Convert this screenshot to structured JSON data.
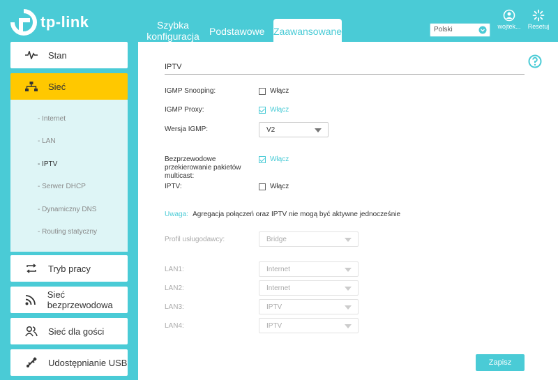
{
  "brand": {
    "name": "tp-link",
    "color": "#4acbd6"
  },
  "nav": {
    "quick_line1": "Szybka",
    "quick_line2": "konfiguracja",
    "basic": "Podstawowe",
    "advanced": "Zaawansowane"
  },
  "header": {
    "language": "Polski",
    "user_label": "wojtek...",
    "reset_label": "Resetuj"
  },
  "sidebar": {
    "items": [
      {
        "label": "Stan",
        "icon": "pulse-icon"
      },
      {
        "label": "Sieć",
        "icon": "network-icon"
      },
      {
        "label": "Tryb pracy",
        "icon": "loop-icon"
      },
      {
        "label": "Sieć bezprzewodowa",
        "icon": "wifi-icon"
      },
      {
        "label": "Sieć dla gości",
        "icon": "guests-icon"
      },
      {
        "label": "Udostępnianie USB",
        "icon": "usb-icon"
      }
    ],
    "submenu": [
      "- Internet",
      "- LAN",
      "- IPTV",
      "- Serwer DHCP",
      "- Dynamiczny DNS",
      "- Routing statyczny"
    ]
  },
  "form": {
    "title": "IPTV",
    "igmp_snooping": {
      "label": "IGMP Snooping:",
      "option": "Włącz",
      "checked": false
    },
    "igmp_proxy": {
      "label": "IGMP Proxy:",
      "option": "Włącz",
      "checked": true
    },
    "igmp_version": {
      "label": "Wersja IGMP:",
      "value": "V2"
    },
    "wireless_multicast": {
      "label_line1": "Bezprzewodowe",
      "label_line2": "przekierowanie pakietów",
      "label_line3": "multicast:",
      "option": "Włącz",
      "checked": true
    },
    "iptv": {
      "label": "IPTV:",
      "option": "Włącz",
      "checked": false
    },
    "note": {
      "label": "Uwaga:",
      "text": "Agregacja połączeń oraz IPTV nie mogą być aktywne jednocześnie"
    },
    "provider_profile": {
      "label": "Profil usługodawcy:",
      "value": "Bridge"
    },
    "lans": [
      {
        "label": "LAN1:",
        "value": "Internet"
      },
      {
        "label": "LAN2:",
        "value": "Internet"
      },
      {
        "label": "LAN3:",
        "value": "IPTV"
      },
      {
        "label": "LAN4:",
        "value": "IPTV"
      }
    ],
    "save_label": "Zapisz"
  }
}
